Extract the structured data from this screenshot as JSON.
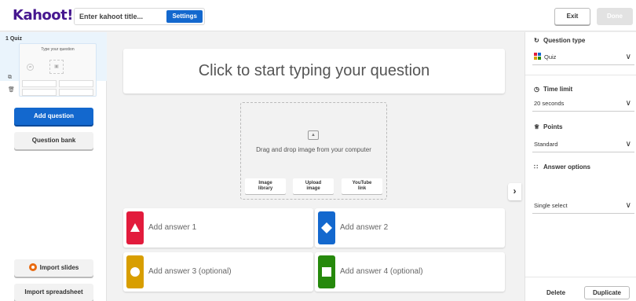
{
  "header": {
    "logo": "Kahoot!",
    "title_placeholder": "Enter kahoot title...",
    "settings_label": "Settings",
    "exit_label": "Exit",
    "done_label": "Done"
  },
  "sidebar": {
    "slide_label": "1  Quiz",
    "thumb_text": "Type your question",
    "thumb_timer": "20",
    "add_question": "Add question",
    "question_bank": "Question bank",
    "import_slides": "Import slides",
    "import_spreadsheet": "Import spreadsheet"
  },
  "editor": {
    "question_placeholder": "Click to start typing your question",
    "media_text": "Drag and drop image from your computer",
    "media_buttons": [
      {
        "line1": "Image",
        "line2": "library"
      },
      {
        "line1": "Upload",
        "line2": "image"
      },
      {
        "line1": "YouTube",
        "line2": "link"
      }
    ],
    "answers": [
      {
        "label": "Add answer 1",
        "color": "#e21b3c",
        "shape": "triangle"
      },
      {
        "label": "Add answer 2",
        "color": "#1368ce",
        "shape": "diamond"
      },
      {
        "label": "Add answer 3 (optional)",
        "color": "#d89e00",
        "shape": "circle"
      },
      {
        "label": "Add answer 4 (optional)",
        "color": "#26890c",
        "shape": "square"
      }
    ]
  },
  "settings_panel": {
    "question_type_label": "Question type",
    "question_type_value": "Quiz",
    "time_limit_label": "Time limit",
    "time_limit_value": "20 seconds",
    "points_label": "Points",
    "points_value": "Standard",
    "answer_options_label": "Answer options",
    "answer_options_value": "Single select",
    "delete_label": "Delete",
    "duplicate_label": "Duplicate"
  },
  "colors": {
    "brand": "#46178f",
    "primary": "#1368ce"
  }
}
